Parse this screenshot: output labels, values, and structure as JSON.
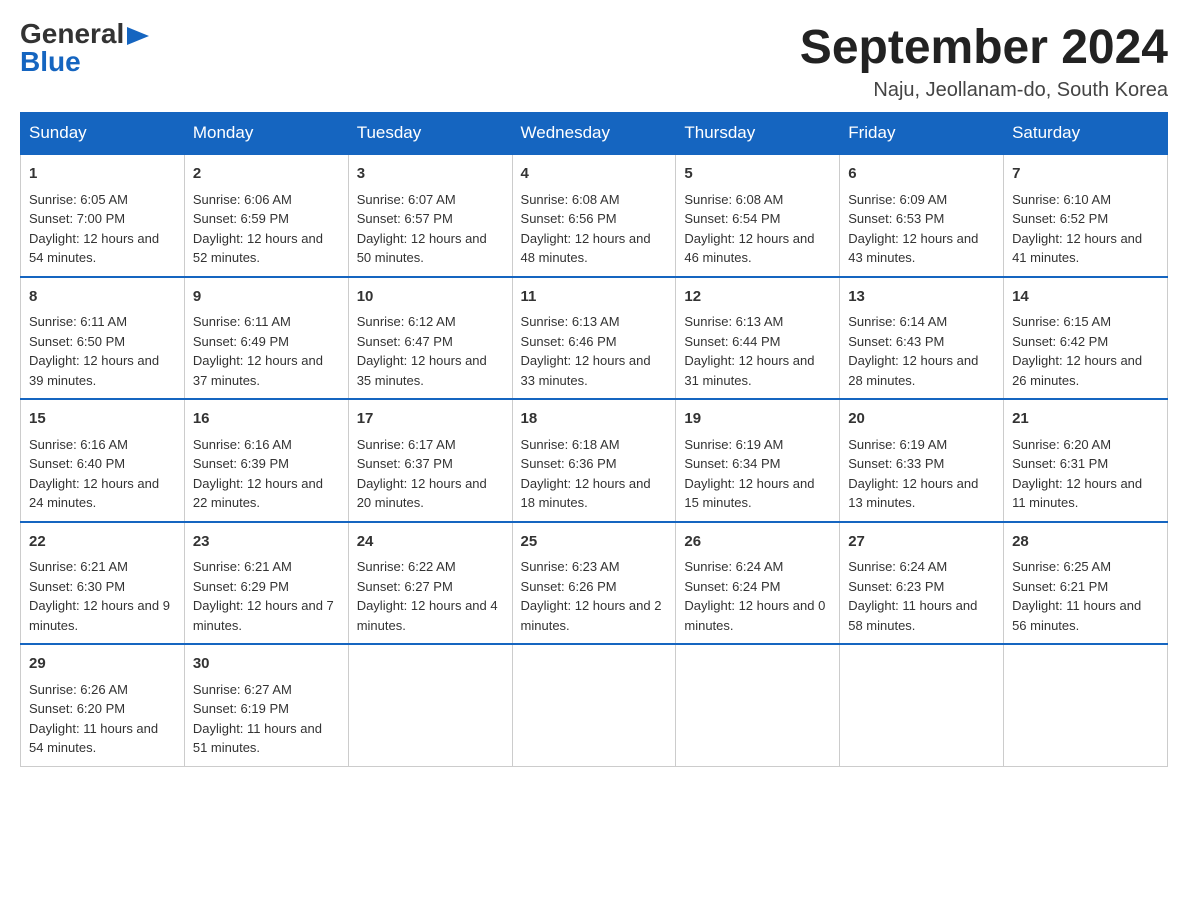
{
  "header": {
    "logo_general": "General",
    "logo_arrow": "▶",
    "logo_blue": "Blue",
    "month_title": "September 2024",
    "location": "Naju, Jeollanam-do, South Korea"
  },
  "days_of_week": [
    "Sunday",
    "Monday",
    "Tuesday",
    "Wednesday",
    "Thursday",
    "Friday",
    "Saturday"
  ],
  "weeks": [
    [
      {
        "day": "1",
        "sunrise": "Sunrise: 6:05 AM",
        "sunset": "Sunset: 7:00 PM",
        "daylight": "Daylight: 12 hours and 54 minutes."
      },
      {
        "day": "2",
        "sunrise": "Sunrise: 6:06 AM",
        "sunset": "Sunset: 6:59 PM",
        "daylight": "Daylight: 12 hours and 52 minutes."
      },
      {
        "day": "3",
        "sunrise": "Sunrise: 6:07 AM",
        "sunset": "Sunset: 6:57 PM",
        "daylight": "Daylight: 12 hours and 50 minutes."
      },
      {
        "day": "4",
        "sunrise": "Sunrise: 6:08 AM",
        "sunset": "Sunset: 6:56 PM",
        "daylight": "Daylight: 12 hours and 48 minutes."
      },
      {
        "day": "5",
        "sunrise": "Sunrise: 6:08 AM",
        "sunset": "Sunset: 6:54 PM",
        "daylight": "Daylight: 12 hours and 46 minutes."
      },
      {
        "day": "6",
        "sunrise": "Sunrise: 6:09 AM",
        "sunset": "Sunset: 6:53 PM",
        "daylight": "Daylight: 12 hours and 43 minutes."
      },
      {
        "day": "7",
        "sunrise": "Sunrise: 6:10 AM",
        "sunset": "Sunset: 6:52 PM",
        "daylight": "Daylight: 12 hours and 41 minutes."
      }
    ],
    [
      {
        "day": "8",
        "sunrise": "Sunrise: 6:11 AM",
        "sunset": "Sunset: 6:50 PM",
        "daylight": "Daylight: 12 hours and 39 minutes."
      },
      {
        "day": "9",
        "sunrise": "Sunrise: 6:11 AM",
        "sunset": "Sunset: 6:49 PM",
        "daylight": "Daylight: 12 hours and 37 minutes."
      },
      {
        "day": "10",
        "sunrise": "Sunrise: 6:12 AM",
        "sunset": "Sunset: 6:47 PM",
        "daylight": "Daylight: 12 hours and 35 minutes."
      },
      {
        "day": "11",
        "sunrise": "Sunrise: 6:13 AM",
        "sunset": "Sunset: 6:46 PM",
        "daylight": "Daylight: 12 hours and 33 minutes."
      },
      {
        "day": "12",
        "sunrise": "Sunrise: 6:13 AM",
        "sunset": "Sunset: 6:44 PM",
        "daylight": "Daylight: 12 hours and 31 minutes."
      },
      {
        "day": "13",
        "sunrise": "Sunrise: 6:14 AM",
        "sunset": "Sunset: 6:43 PM",
        "daylight": "Daylight: 12 hours and 28 minutes."
      },
      {
        "day": "14",
        "sunrise": "Sunrise: 6:15 AM",
        "sunset": "Sunset: 6:42 PM",
        "daylight": "Daylight: 12 hours and 26 minutes."
      }
    ],
    [
      {
        "day": "15",
        "sunrise": "Sunrise: 6:16 AM",
        "sunset": "Sunset: 6:40 PM",
        "daylight": "Daylight: 12 hours and 24 minutes."
      },
      {
        "day": "16",
        "sunrise": "Sunrise: 6:16 AM",
        "sunset": "Sunset: 6:39 PM",
        "daylight": "Daylight: 12 hours and 22 minutes."
      },
      {
        "day": "17",
        "sunrise": "Sunrise: 6:17 AM",
        "sunset": "Sunset: 6:37 PM",
        "daylight": "Daylight: 12 hours and 20 minutes."
      },
      {
        "day": "18",
        "sunrise": "Sunrise: 6:18 AM",
        "sunset": "Sunset: 6:36 PM",
        "daylight": "Daylight: 12 hours and 18 minutes."
      },
      {
        "day": "19",
        "sunrise": "Sunrise: 6:19 AM",
        "sunset": "Sunset: 6:34 PM",
        "daylight": "Daylight: 12 hours and 15 minutes."
      },
      {
        "day": "20",
        "sunrise": "Sunrise: 6:19 AM",
        "sunset": "Sunset: 6:33 PM",
        "daylight": "Daylight: 12 hours and 13 minutes."
      },
      {
        "day": "21",
        "sunrise": "Sunrise: 6:20 AM",
        "sunset": "Sunset: 6:31 PM",
        "daylight": "Daylight: 12 hours and 11 minutes."
      }
    ],
    [
      {
        "day": "22",
        "sunrise": "Sunrise: 6:21 AM",
        "sunset": "Sunset: 6:30 PM",
        "daylight": "Daylight: 12 hours and 9 minutes."
      },
      {
        "day": "23",
        "sunrise": "Sunrise: 6:21 AM",
        "sunset": "Sunset: 6:29 PM",
        "daylight": "Daylight: 12 hours and 7 minutes."
      },
      {
        "day": "24",
        "sunrise": "Sunrise: 6:22 AM",
        "sunset": "Sunset: 6:27 PM",
        "daylight": "Daylight: 12 hours and 4 minutes."
      },
      {
        "day": "25",
        "sunrise": "Sunrise: 6:23 AM",
        "sunset": "Sunset: 6:26 PM",
        "daylight": "Daylight: 12 hours and 2 minutes."
      },
      {
        "day": "26",
        "sunrise": "Sunrise: 6:24 AM",
        "sunset": "Sunset: 6:24 PM",
        "daylight": "Daylight: 12 hours and 0 minutes."
      },
      {
        "day": "27",
        "sunrise": "Sunrise: 6:24 AM",
        "sunset": "Sunset: 6:23 PM",
        "daylight": "Daylight: 11 hours and 58 minutes."
      },
      {
        "day": "28",
        "sunrise": "Sunrise: 6:25 AM",
        "sunset": "Sunset: 6:21 PM",
        "daylight": "Daylight: 11 hours and 56 minutes."
      }
    ],
    [
      {
        "day": "29",
        "sunrise": "Sunrise: 6:26 AM",
        "sunset": "Sunset: 6:20 PM",
        "daylight": "Daylight: 11 hours and 54 minutes."
      },
      {
        "day": "30",
        "sunrise": "Sunrise: 6:27 AM",
        "sunset": "Sunset: 6:19 PM",
        "daylight": "Daylight: 11 hours and 51 minutes."
      },
      null,
      null,
      null,
      null,
      null
    ]
  ]
}
